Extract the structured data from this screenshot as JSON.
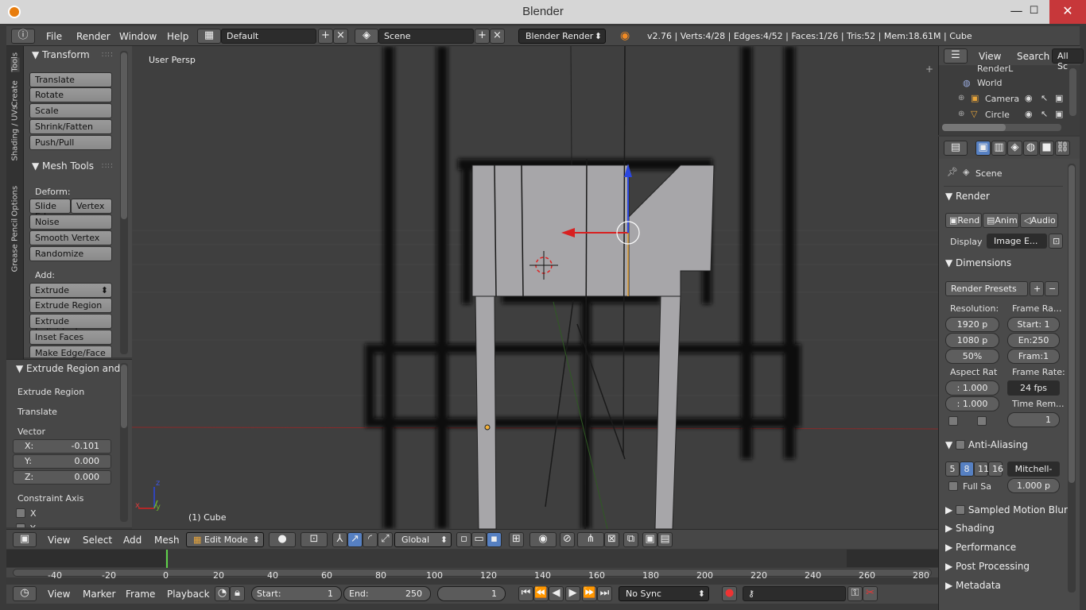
{
  "window": {
    "title": "Blender",
    "min": "—",
    "max": "☐",
    "close": "✕"
  },
  "info": {
    "menus": [
      "File",
      "Render",
      "Window",
      "Help"
    ],
    "layout": "Default",
    "scene": "Scene",
    "engine": "Blender Render",
    "stats": "v2.76 | Verts:4/28 | Edges:4/52 | Faces:1/26 | Tris:52 | Mem:18.61M | Cube"
  },
  "tabs": [
    "Tools",
    "Create",
    "Shading / UVs",
    "Options",
    "Grease Pencil"
  ],
  "tools": {
    "transform_header": "Transform",
    "transform": [
      "Translate",
      "Rotate",
      "Scale",
      "Shrink/Fatten",
      "Push/Pull"
    ],
    "mesh_header": "Mesh Tools",
    "deform_label": "Deform:",
    "slide_edge": "Slide Ed",
    "vertex": "Vertex",
    "deform": [
      "Noise",
      "Smooth Vertex",
      "Randomize"
    ],
    "add_label": "Add:",
    "extrude": "Extrude",
    "add": [
      "Extrude Region",
      "Extrude Individual",
      "Inset Faces",
      "Make Edge/Face"
    ]
  },
  "operator": {
    "header": "Extrude Region and",
    "items": [
      "Extrude Region",
      "Translate"
    ],
    "vector_label": "Vector",
    "x_label": "X:",
    "x": "-0.101",
    "y_label": "Y:",
    "y": "0.000",
    "z_label": "Z:",
    "z": "0.000",
    "constraint": "Constraint Axis",
    "cx": "X",
    "cy": "Y"
  },
  "viewport": {
    "view_label": "User Persp",
    "object_label": "(1) Cube",
    "axis_x": "x",
    "axis_y": "y",
    "axis_z": "z"
  },
  "header3d": {
    "menus": [
      "View",
      "Select",
      "Add",
      "Mesh"
    ],
    "mode": "Edit Mode",
    "orientation": "Global"
  },
  "timeline": {
    "ticks": [
      "-40",
      "-20",
      "0",
      "20",
      "40",
      "60",
      "80",
      "100",
      "120",
      "140",
      "160",
      "180",
      "200",
      "220",
      "240",
      "260",
      "280"
    ]
  },
  "tlbar": {
    "menus": [
      "View",
      "Marker",
      "Frame",
      "Playback"
    ],
    "start_label": "Start:",
    "start": "1",
    "end_label": "End:",
    "end": "250",
    "current": "1",
    "sync": "No Sync"
  },
  "outliner": {
    "menus": [
      "View",
      "Search"
    ],
    "filter": "All Sc",
    "items": [
      "RenderL",
      "World",
      "Camera",
      "Circle"
    ]
  },
  "props": {
    "scene": "Scene",
    "render_header": "Render",
    "render_btns": [
      "Rend",
      "Anim",
      "Audio"
    ],
    "display_label": "Display",
    "display": "Image E...",
    "dimensions_header": "Dimensions",
    "presets": "Render Presets",
    "resolution_label": "Resolution:",
    "res_x": "1920 p",
    "res_y": "1080 p",
    "res_pct": "50%",
    "frame_range_label": "Frame Ra...",
    "frame_start": "Start: 1",
    "frame_end": "En:250",
    "frame_step": "Fram:1",
    "aspect_label": "Aspect Rat",
    "aspect_x": ": 1.000",
    "aspect_y": ": 1.000",
    "frame_rate_label": "Frame Rate:",
    "fps": "24 fps",
    "time_remap_label": "Time Rem...",
    "time_remap": "1",
    "aa_header": "Anti-Aliasing",
    "aa_samples": [
      "5",
      "8",
      "11",
      "16"
    ],
    "aa_filter": "Mitchell-",
    "full_sample": "Full Sa",
    "filter_size": "1.000 p",
    "motion_blur": "Sampled Motion Blur",
    "collapsed": [
      "Shading",
      "Performance",
      "Post Processing",
      "Metadata"
    ]
  },
  "colors": {
    "accent": "#5680c2",
    "x_axis": "#d33b3b",
    "y_axis": "#6fae2f",
    "z_axis": "#3d56e0",
    "mesh": "#a7a6a9"
  }
}
